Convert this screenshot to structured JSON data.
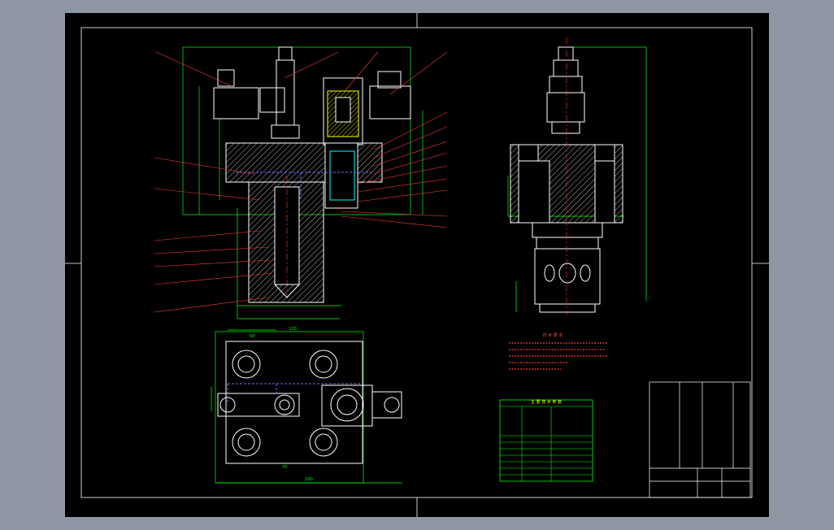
{
  "drawing": {
    "background": "#000000",
    "line_colors": {
      "frame": "#ffffff",
      "outline": "#ffffff",
      "dimension": "#00ff00",
      "leader": "#ff3b3b",
      "hidden": "#6b6bff",
      "hatch": "#ffffff",
      "accent": "#ffff00",
      "cyan": "#00ffff"
    }
  },
  "views": {
    "front_section": "front-section-view",
    "side": "side-view",
    "plan": "plan-view"
  },
  "dimensions": {
    "plan_width": "120",
    "plan_top_small": "50",
    "plan_bottom": "100",
    "plan_inner": "70"
  },
  "notes": {
    "title": "技 术 要 求",
    "lines": [
      "",
      "",
      "",
      "",
      ""
    ]
  },
  "parameter_table": {
    "title": "主 要 技 术 参 数"
  },
  "title_block": {
    "name": "",
    "drawing_no": ""
  }
}
